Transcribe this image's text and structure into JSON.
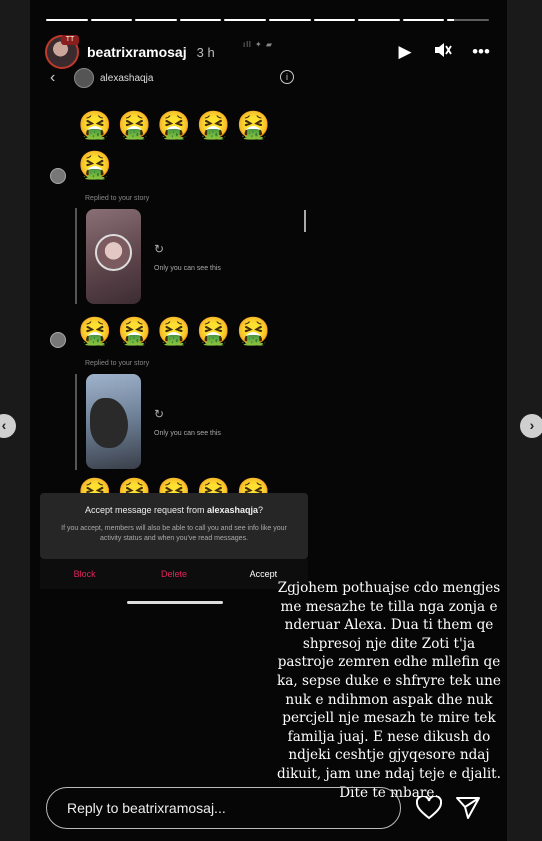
{
  "story": {
    "username": "beatrixramosaj",
    "age": "3 h",
    "avatar_badge": "TT",
    "progress": {
      "segments": 10,
      "active_index": 9,
      "active_fill": 0.15
    },
    "icons": [
      "play-icon",
      "mute-icon",
      "more-icon"
    ],
    "colors": {
      "background": "#060606",
      "ring": "#c0392b",
      "danger": "#e0245e"
    }
  },
  "screenshot": {
    "status_bar": "ıll ✦ ▰",
    "header_username": "alexashaqja",
    "emoji": "🤮",
    "emoji_rows": [
      5,
      1,
      5,
      5
    ],
    "replied_label": "Replied to your story",
    "only_you_label": "Only you can see this",
    "request": {
      "title_prefix": "Accept message request from ",
      "title_user": "alexashaqja",
      "title_suffix": "?",
      "subtitle": "If you accept, members will also be able to call you and see info like your activity status and when you've read messages.",
      "block": "Block",
      "delete": "Delete",
      "accept": "Accept"
    }
  },
  "caption": "Zgjohem pothuajse cdo mengjes me mesazhe te tilla nga zonja e nderuar Alexa. Dua ti them qe shpresoj nje dite Zoti t'ja pastroje zemren edhe mllefin qe ka, sepse duke e shfryre tek une nuk e ndihmon aspak dhe nuk percjell nje mesazh te mire tek familja juaj. E nese dikush do ndjeki ceshtje gjyqesore ndaj dikuit, jam une ndaj teje e djalit. Dite te mbare.",
  "reply": {
    "placeholder": "Reply to beatrixramosaj..."
  }
}
